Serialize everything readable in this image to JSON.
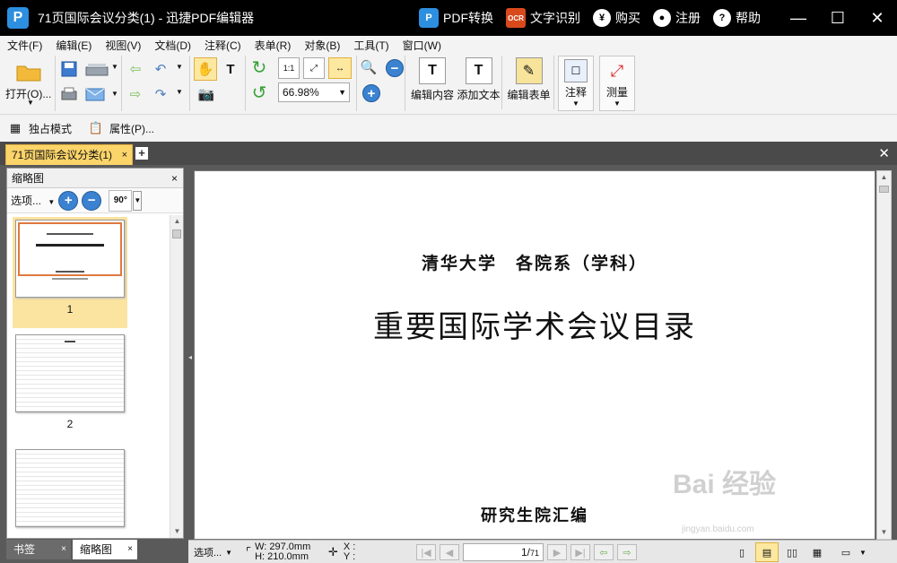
{
  "window": {
    "title": "71页国际会议分类(1) - 迅捷PDF编辑器",
    "logo": "P",
    "actions": [
      {
        "label": "PDF转换",
        "icon": "pdf-convert-icon"
      },
      {
        "label": "文字识别",
        "icon": "ocr-icon",
        "badge": "OCR"
      },
      {
        "label": "购买",
        "icon": "yen-icon",
        "glyph": "¥"
      },
      {
        "label": "注册",
        "icon": "user-icon",
        "glyph": "●"
      },
      {
        "label": "帮助",
        "icon": "help-icon",
        "glyph": "?"
      }
    ],
    "controls": {
      "minimize": "—",
      "maximize": "☐",
      "close": "✕"
    }
  },
  "menu": [
    "文件(F)",
    "编辑(E)",
    "视图(V)",
    "文档(D)",
    "注释(C)",
    "表单(R)",
    "对象(B)",
    "工具(T)",
    "窗口(W)"
  ],
  "toolbar": {
    "open_label": "打开(O)...",
    "zoom_value": "66.98%",
    "edit_content_label": "编辑内容",
    "add_text_label": "添加文本",
    "edit_form_label": "编辑表单",
    "annotate_label": "注释",
    "measure_label": "测量",
    "exclusive_mode_label": "独占模式",
    "properties_label": "属性(P)..."
  },
  "tabs": {
    "doc_tab_label": "71页国际会议分类(1)",
    "close": "×",
    "add": "+"
  },
  "left_panel": {
    "title": "缩略图",
    "options_label": "选项...",
    "rotate_label": "90°",
    "thumbnails": [
      {
        "page": "1",
        "selected": true
      },
      {
        "page": "2",
        "selected": false
      }
    ],
    "bottom_tabs": [
      {
        "label": "书签",
        "active": false
      },
      {
        "label": "缩略图",
        "active": true
      }
    ]
  },
  "document": {
    "header_line": "清华大学　各院系（学科）",
    "main_title": "重要国际学术会议目录",
    "footer_line": "研究生院汇编"
  },
  "statusbar": {
    "options_label": "选项...",
    "width_label": "W: 297.0mm",
    "height_label": "H: 210.0mm",
    "x_label": "X :",
    "y_label": "Y :",
    "page_current": "1",
    "page_total": "71"
  },
  "watermark": {
    "text": "Bai 经验",
    "url_text": "jingyan.baidu.com"
  },
  "colors": {
    "titlebar_bg": "#000000",
    "tab_active_bg": "#fbd46a",
    "panel_dark_bg": "#5a5a5a",
    "accent_blue": "#3b82d1"
  }
}
